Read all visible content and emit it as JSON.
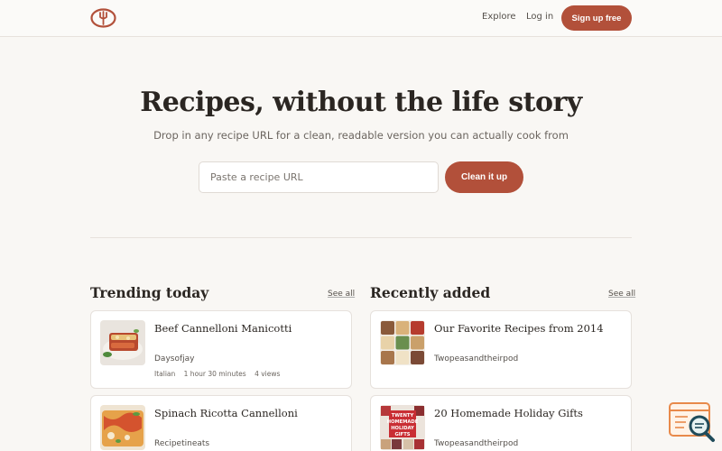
{
  "nav": {
    "explore": "Explore",
    "login": "Log in",
    "signup": "Sign up free"
  },
  "hero": {
    "title": "Recipes, without the life story",
    "subtitle": "Drop in any recipe URL for a clean, readable version you can actually cook from",
    "input_placeholder": "Paste a recipe URL",
    "button": "Clean it up"
  },
  "trending": {
    "title": "Trending today",
    "see_all": "See all",
    "items": [
      {
        "title": "Beef Cannelloni Manicotti",
        "source": "Daysofjay",
        "cuisine": "Italian",
        "time": "1 hour 30 minutes",
        "views": "4 views"
      },
      {
        "title": "Spinach Ricotta Cannelloni",
        "source": "Recipetineats"
      }
    ]
  },
  "recent": {
    "title": "Recently added",
    "see_all": "See all",
    "items": [
      {
        "title": "Our Favorite Recipes from 2014",
        "source": "Twopeasandtheirpod"
      },
      {
        "title": "20 Homemade Holiday Gifts",
        "source": "Twopeasandtheirpod",
        "thumb_text": [
          "TWENTY",
          "HOMEMADE",
          "HOLIDAY",
          "GIFTS"
        ]
      }
    ]
  },
  "colors": {
    "accent": "#b2503a",
    "background": "#f9f7f4",
    "text": "#2b2622"
  },
  "icons": {
    "logo": "fork-in-bowl-logo-icon",
    "widget": "search-zoom-widget-icon"
  }
}
